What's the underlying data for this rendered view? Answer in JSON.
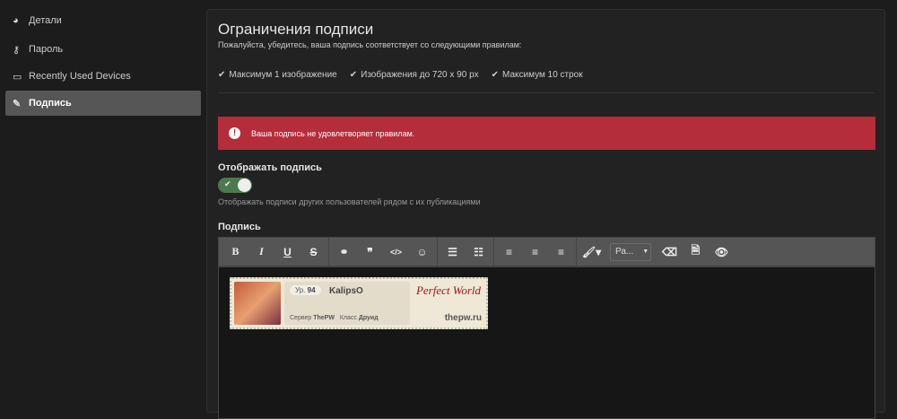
{
  "sidebar": {
    "items": [
      {
        "label": "Детали",
        "icon": "dashboard-icon"
      },
      {
        "label": "Пароль",
        "icon": "key-icon"
      },
      {
        "label": "Recently Used Devices",
        "icon": "laptop-icon"
      },
      {
        "label": "Подпись",
        "icon": "pencil-icon",
        "active": true
      }
    ]
  },
  "main": {
    "title": "Ограничения подписи",
    "subtitle": "Пожалуйста, убедитесь, ваша подпись соответствует со следующими правилам:",
    "rules": [
      "Максимум 1 изображение",
      "Изображения до 720 x 90 px",
      "Максимум 10 строк"
    ],
    "alert": {
      "text": "Ваша подпись не удовлетворяет правилам.",
      "color": "#b52c3a"
    },
    "show_signature": {
      "label": "Отображать подпись",
      "enabled": true,
      "help": "Отображать подписи других пользователей рядом с их публикациями"
    },
    "signature_label": "Подпись",
    "toolbar": {
      "font_size": "Ра...",
      "buttons": [
        "bold",
        "italic",
        "underline",
        "strikethrough",
        "link",
        "quote",
        "code",
        "emoji",
        "bullet-list",
        "numbered-list",
        "align-left",
        "align-center",
        "align-right",
        "color",
        "eraser",
        "source",
        "preview"
      ]
    },
    "signature_image": {
      "level_label": "Ур.",
      "level": "94",
      "name": "KalipsO",
      "server_label": "Сервер",
      "server": "ThePW",
      "class_label": "Класс",
      "class": "Друид",
      "logo_text": "Perfect World",
      "site": "thepw.ru"
    }
  }
}
